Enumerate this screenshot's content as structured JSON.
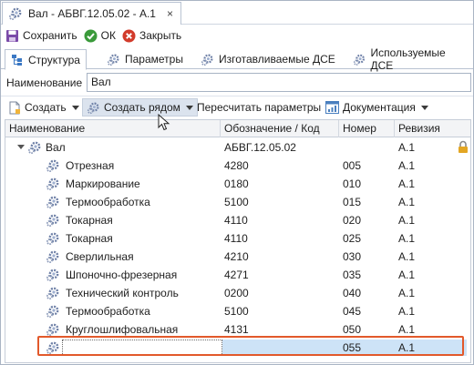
{
  "window": {
    "title": "Вал - АБВГ.12.05.02 - А.1",
    "close_glyph": "×"
  },
  "actions": {
    "save": "Сохранить",
    "ok": "ОК",
    "close": "Закрыть"
  },
  "tabs": [
    {
      "label": "Структура",
      "active": true
    },
    {
      "label": "Параметры",
      "active": false
    },
    {
      "label": "Изготавливаемые ДСЕ",
      "active": false
    },
    {
      "label": "Используемые ДСЕ",
      "active": false
    }
  ],
  "name_field": {
    "label": "Наименование",
    "value": "Вал"
  },
  "toolbar": {
    "create": "Создать",
    "create_beside": "Создать рядом",
    "recalc": "Пересчитать параметры",
    "docs": "Документация"
  },
  "grid": {
    "columns": [
      "Наименование",
      "Обозначение / Код",
      "Номер",
      "Ревизия"
    ],
    "root": {
      "name": "Вал",
      "code": "АБВГ.12.05.02",
      "number": "",
      "revision": "А.1"
    },
    "rows": [
      {
        "name": "Отрезная",
        "code": "4280",
        "number": "005",
        "revision": "А.1"
      },
      {
        "name": "Маркирование",
        "code": "0180",
        "number": "010",
        "revision": "А.1"
      },
      {
        "name": "Термообработка",
        "code": "5100",
        "number": "015",
        "revision": "А.1"
      },
      {
        "name": "Токарная",
        "code": "4110",
        "number": "020",
        "revision": "А.1"
      },
      {
        "name": "Токарная",
        "code": "4110",
        "number": "025",
        "revision": "А.1"
      },
      {
        "name": "Сверлильная",
        "code": "4210",
        "number": "030",
        "revision": "А.1"
      },
      {
        "name": "Шпоночно-фрезерная",
        "code": "4271",
        "number": "035",
        "revision": "А.1"
      },
      {
        "name": "Технический контроль",
        "code": "0200",
        "number": "040",
        "revision": "А.1"
      },
      {
        "name": "Термообработка",
        "code": "5100",
        "number": "045",
        "revision": "А.1"
      },
      {
        "name": "Круглошлифовальная",
        "code": "4131",
        "number": "050",
        "revision": "А.1"
      }
    ],
    "new_row": {
      "name": "",
      "code": "",
      "number": "055",
      "revision": "А.1"
    }
  },
  "colors": {
    "highlight": "#e2592b",
    "selection": "#cde3f7",
    "ok_green": "#3a9a3a",
    "close_red": "#d23b2b"
  }
}
